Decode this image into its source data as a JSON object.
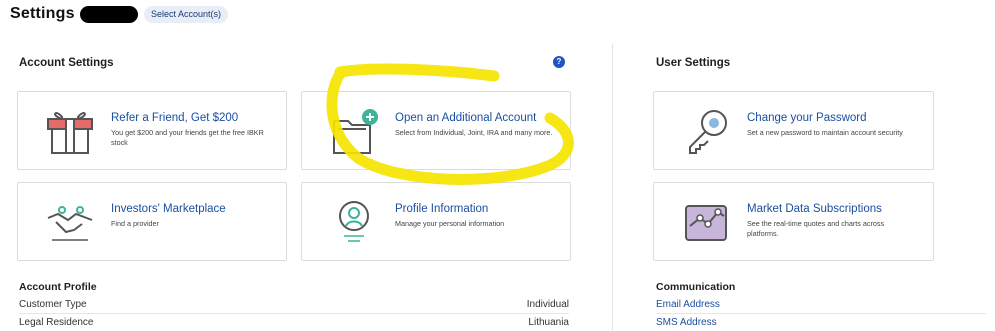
{
  "header": {
    "title": "Settings",
    "select_account_label": "Select Account(s)"
  },
  "account_settings": {
    "title": "Account Settings",
    "help_icon_glyph": "?",
    "cards": [
      {
        "title": "Refer a Friend, Get $200",
        "desc": "You get $200 and your friends get the free IBKR stock",
        "icon": "gift-icon"
      },
      {
        "title": "Open an Additional Account",
        "desc": "Select from Individual, Joint, IRA and many more.",
        "icon": "folder-plus-icon"
      },
      {
        "title": "Investors' Marketplace",
        "desc": "Find a provider",
        "icon": "handshake-icon"
      },
      {
        "title": "Profile Information",
        "desc": "Manage your personal information",
        "icon": "profile-icon"
      }
    ]
  },
  "user_settings": {
    "title": "User Settings",
    "cards": [
      {
        "title": "Change your Password",
        "desc": "Set a new password to maintain account security",
        "icon": "key-icon"
      },
      {
        "title": "Market Data Subscriptions",
        "desc": "See the real-time quotes and charts across platforms.",
        "icon": "chart-icon"
      }
    ]
  },
  "account_profile": {
    "title": "Account Profile",
    "rows": [
      {
        "label": "Customer Type",
        "value": "Individual"
      },
      {
        "label": "Legal Residence",
        "value": "Lithuania"
      }
    ]
  },
  "communication": {
    "title": "Communication",
    "links": [
      "Email Address",
      "SMS Address"
    ]
  },
  "colors": {
    "link_blue": "#1b4fa0",
    "accent_teal": "#3cb39a",
    "highlight_yellow": "#f5e400"
  }
}
